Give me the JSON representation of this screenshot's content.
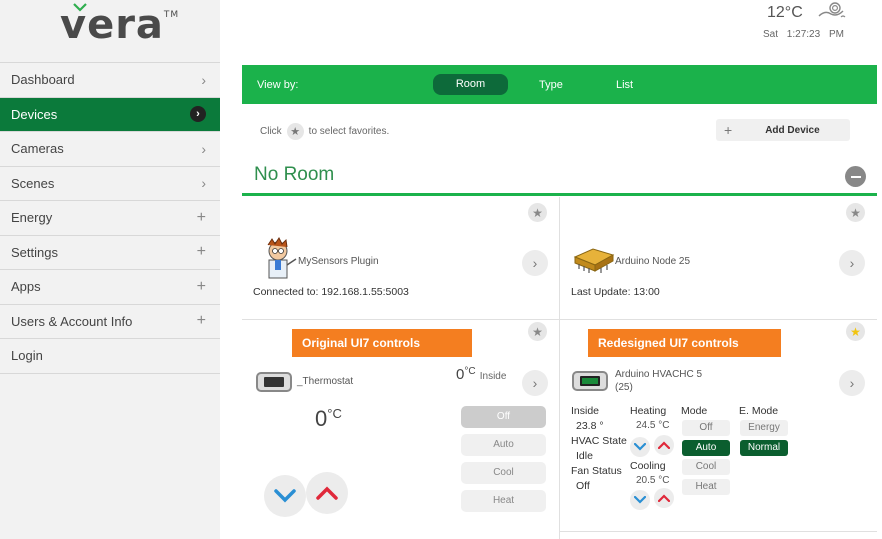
{
  "brand": {
    "logo": "vera",
    "tm": "TM"
  },
  "sidebar": {
    "items": [
      {
        "label": "Dashboard",
        "indicator": "chevron"
      },
      {
        "label": "Devices",
        "indicator": "chevron-active"
      },
      {
        "label": "Cameras",
        "indicator": "chevron"
      },
      {
        "label": "Scenes",
        "indicator": "chevron"
      },
      {
        "label": "Energy",
        "indicator": "plus"
      },
      {
        "label": "Settings",
        "indicator": "plus"
      },
      {
        "label": "Apps",
        "indicator": "plus"
      },
      {
        "label": "Users & Account Info",
        "indicator": "plus"
      },
      {
        "label": "Login",
        "indicator": "none"
      }
    ]
  },
  "header": {
    "temperature": "12°C",
    "day": "Sat",
    "time": "1:27:23 PM",
    "weather_icon": "cloud-wind-icon"
  },
  "viewbar": {
    "label": "View by:",
    "tabs": [
      "Room",
      "Type",
      "List"
    ],
    "active": "Room"
  },
  "favorites_hint": {
    "before": "Click",
    "after": "to select favorites."
  },
  "add_device": {
    "label": "Add Device"
  },
  "room": {
    "title": "No Room"
  },
  "devices": {
    "mysensors": {
      "name": "MySensors Plugin",
      "meta_label": "Connected to:",
      "meta_value": "192.168.1.55:5003"
    },
    "arduino_node": {
      "name": "Arduino Node 25",
      "meta_label": "Last Update:",
      "meta_value": "13:00"
    },
    "thermostat": {
      "banner": "Original UI7 controls",
      "name": "_Thermostat",
      "inside_temp": "0",
      "inside_unit": "°C",
      "inside_label": "Inside",
      "setpoint": "0",
      "setpoint_unit": "°C",
      "modes": [
        "Off",
        "Auto",
        "Cool",
        "Heat"
      ],
      "selected_mode": "Off"
    },
    "hvac": {
      "banner": "Redesigned UI7 controls",
      "name": "Arduino HVACHC 5",
      "id": "(25)",
      "inside_label": "Inside",
      "inside_value": "23.8 °",
      "hvac_state_label": "HVAC State",
      "hvac_state_value": "Idle",
      "fan_status_label": "Fan Status",
      "fan_status_value": "Off",
      "heating_label": "Heating",
      "heating_value": "24.5 °C",
      "cooling_label": "Cooling",
      "cooling_value": "20.5 °C",
      "mode_label": "Mode",
      "modes": [
        "Off",
        "Auto",
        "Cool",
        "Heat"
      ],
      "selected_mode": "Auto",
      "emode_label": "E. Mode",
      "emodes": [
        "Energy",
        "Normal"
      ],
      "selected_emode": "Normal"
    }
  },
  "colors": {
    "accent": "#1bb24b",
    "dark_green": "#0b7a3b",
    "orange": "#f47e20",
    "blue_arrow": "#2a8fd4",
    "red_arrow": "#e0283a"
  }
}
